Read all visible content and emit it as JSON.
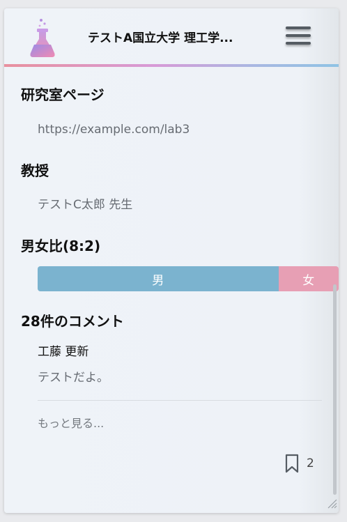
{
  "header": {
    "title": "テストA国立大学 理工学...",
    "logo_icon": "flask-icon",
    "menu_icon": "hamburger-menu-icon"
  },
  "lab_page": {
    "heading": "研究室ページ",
    "url": "https://example.com/lab3"
  },
  "professor": {
    "heading": "教授",
    "name": "テストC太郎 先生"
  },
  "gender_ratio": {
    "heading": "男女比(8:2)",
    "male_label": "男",
    "female_label": "女",
    "male_share": 0.8,
    "female_share": 0.2,
    "male_color": "#7bb3cf",
    "female_color": "#e79fb4"
  },
  "comments": {
    "heading": "28件のコメント",
    "items": [
      {
        "author": "工藤 更新",
        "text": "テストだよ。"
      }
    ],
    "more_label": "もっと見る..."
  },
  "bookmark": {
    "icon": "bookmark-icon",
    "count": "2"
  },
  "colors": {
    "accent_gradient": [
      "#e8909e",
      "#d79ad7",
      "#a8b8e2",
      "#8fc3e4"
    ]
  }
}
